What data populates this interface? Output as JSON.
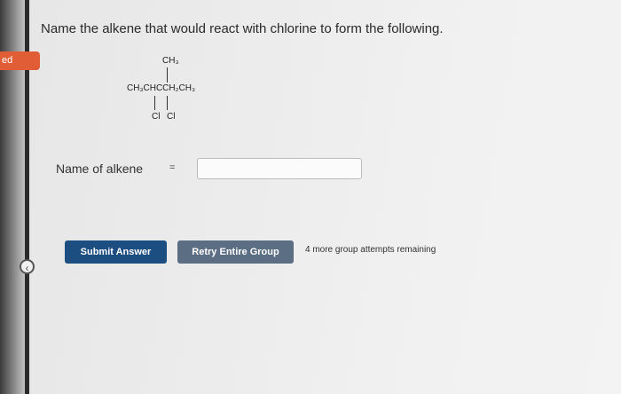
{
  "sidebar": {
    "tab_label": "ed"
  },
  "question": {
    "text": "Name the alkene that would react with chlorine to form the following."
  },
  "structure": {
    "top_group": "CH₃",
    "main_chain": "CH₃CHCCH₂CH₃",
    "cl_left": "Cl",
    "cl_right": "Cl"
  },
  "answer": {
    "label": "Name of alkene",
    "equals": "=",
    "value": ""
  },
  "buttons": {
    "submit": "Submit Answer",
    "retry": "Retry Entire Group"
  },
  "attempts_text": "4 more group attempts remaining",
  "colors": {
    "submit_bg": "#1d4e82",
    "retry_bg": "#5b6e84",
    "tab_bg": "#e15d36"
  }
}
